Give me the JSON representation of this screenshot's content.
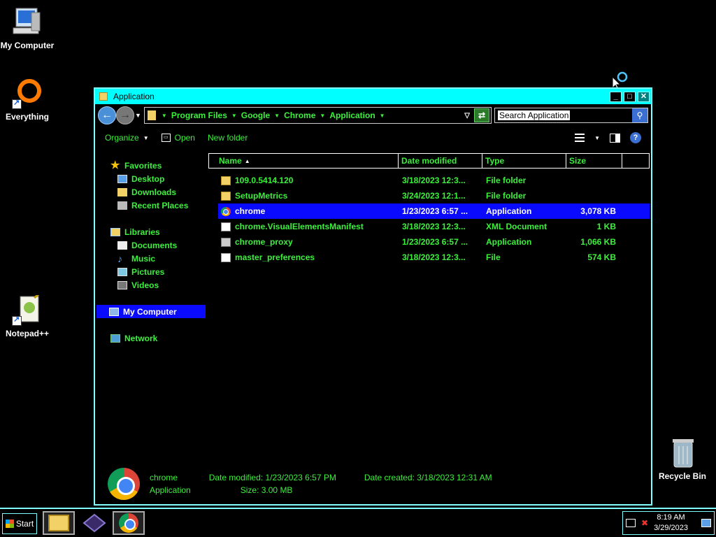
{
  "desktop": {
    "icons": [
      {
        "label": "My Computer"
      },
      {
        "label": "Everything"
      },
      {
        "label": "Notepad++"
      },
      {
        "label": "Recycle Bin"
      }
    ]
  },
  "window": {
    "title": "Application",
    "buttons": {
      "minimize": "_",
      "maximize": "□",
      "close": "✕"
    },
    "breadcrumb": [
      "Program Files",
      "Google",
      "Chrome",
      "Application"
    ],
    "search_placeholder": "Search Application",
    "toolbar": {
      "organize": "Organize",
      "open": "Open",
      "new_folder": "New folder"
    }
  },
  "nav": {
    "favorites": "Favorites",
    "desktop": "Desktop",
    "downloads": "Downloads",
    "recent": "Recent Places",
    "libraries": "Libraries",
    "documents": "Documents",
    "music": "Music",
    "pictures": "Pictures",
    "videos": "Videos",
    "my_computer": "My Computer",
    "network": "Network"
  },
  "list": {
    "columns": [
      "Name",
      "Date modified",
      "Type",
      "Size"
    ],
    "rows": [
      {
        "name": "109.0.5414.120",
        "date": "3/18/2023 12:3...",
        "type": "File folder",
        "size": "",
        "icon": "folder-icon"
      },
      {
        "name": "SetupMetrics",
        "date": "3/24/2023 12:1...",
        "type": "File folder",
        "size": "",
        "icon": "folder-icon"
      },
      {
        "name": "chrome",
        "date": "1/23/2023 6:57 ...",
        "type": "Application",
        "size": "3,078 KB",
        "icon": "chrome-icon"
      },
      {
        "name": "chrome.VisualElementsManifest",
        "date": "3/18/2023 12:3...",
        "type": "XML Document",
        "size": "1 KB",
        "icon": "xml-file-icon"
      },
      {
        "name": "chrome_proxy",
        "date": "1/23/2023 6:57 ...",
        "type": "Application",
        "size": "1,066 KB",
        "icon": "application-icon"
      },
      {
        "name": "master_preferences",
        "date": "3/18/2023 12:3...",
        "type": "File",
        "size": "574 KB",
        "icon": "file-icon"
      }
    ]
  },
  "details": {
    "name": "chrome",
    "type": "Application",
    "date_modified_label": "Date modified:",
    "date_modified": "1/23/2023 6:57 PM",
    "size_label": "Size:",
    "size": "3.00 MB",
    "date_created_label": "Date created:",
    "date_created": "3/18/2023 12:31 AM"
  },
  "taskbar": {
    "start": "Start",
    "time": "8:19 AM",
    "date": "3/29/2023"
  }
}
